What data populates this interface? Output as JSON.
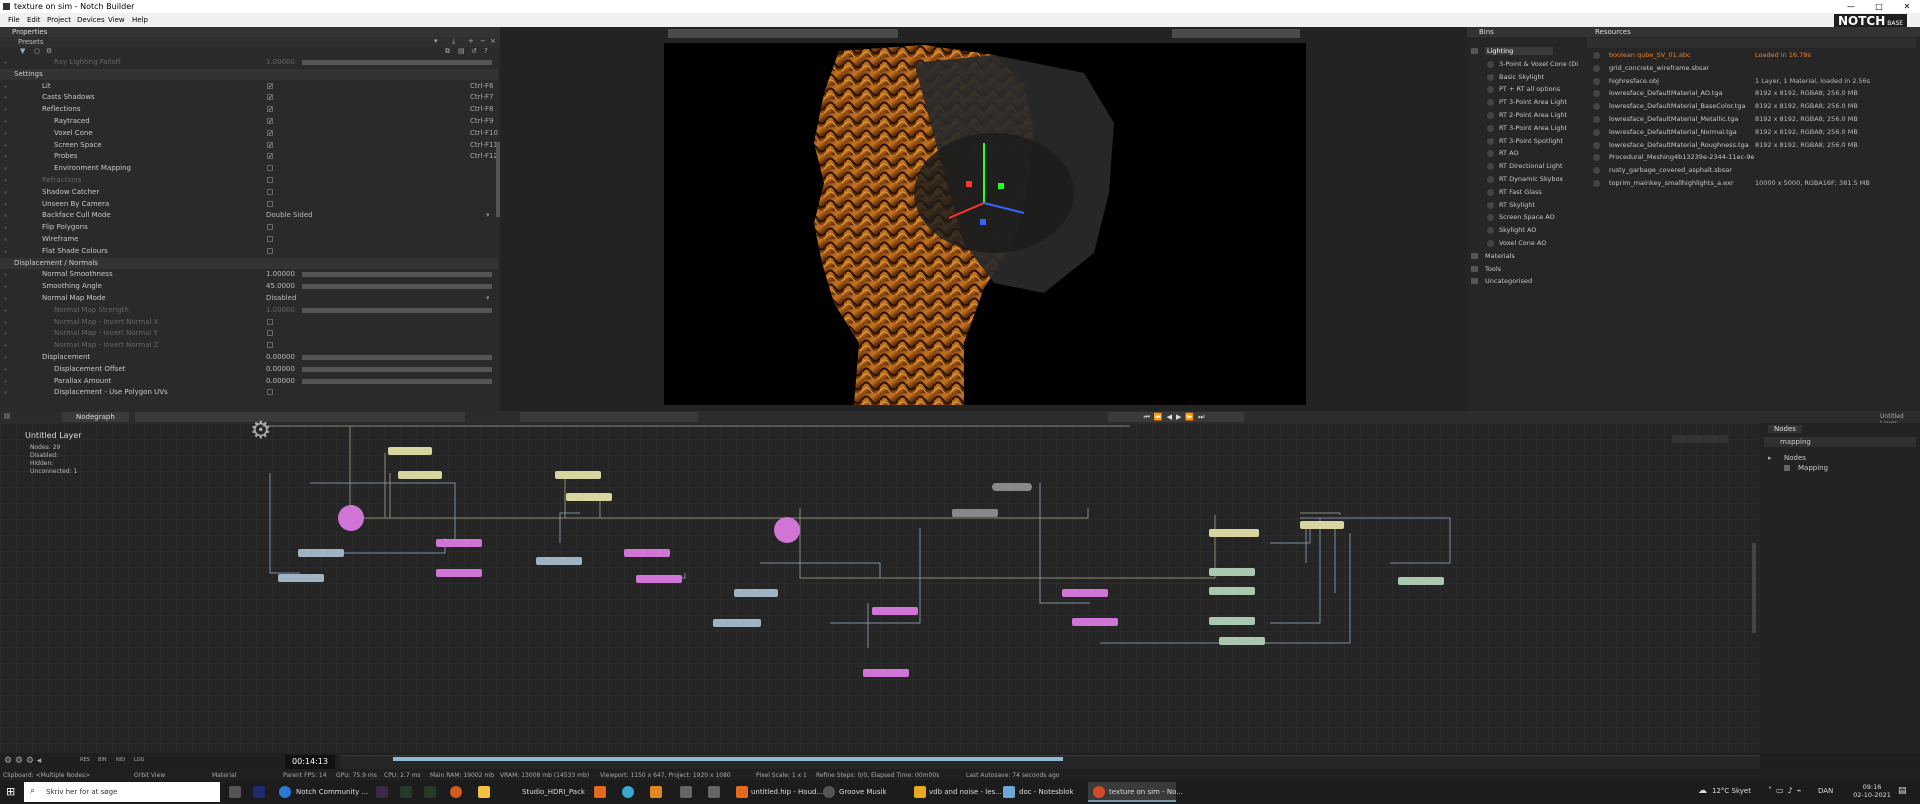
{
  "window": {
    "title": "texture on sim - Notch Builder",
    "min": "—",
    "max": "□",
    "close": "✕"
  },
  "menu": [
    "File",
    "Edit",
    "Project",
    "Devices",
    "View",
    "Help"
  ],
  "logo": {
    "text": "NOTCH",
    "sub": "BASE"
  },
  "properties": {
    "title": "Properties",
    "presets": "Presets",
    "rows": [
      {
        "label": "Ray Lighting Falloff",
        "value": "1.00000",
        "type": "slider",
        "indent": 54,
        "dim": true
      },
      {
        "label": "Settings",
        "type": "section"
      },
      {
        "label": "Lit",
        "type": "check",
        "checked": true,
        "shortcut": "Ctrl-F6",
        "indent": 42
      },
      {
        "label": "Casts Shadows",
        "type": "check",
        "checked": true,
        "shortcut": "Ctrl-F7",
        "indent": 42
      },
      {
        "label": "Reflections",
        "type": "check",
        "checked": true,
        "shortcut": "Ctrl-F8",
        "indent": 42
      },
      {
        "label": "Raytraced",
        "type": "check",
        "checked": true,
        "shortcut": "Ctrl-F9",
        "indent": 54
      },
      {
        "label": "Voxel Cone",
        "type": "check",
        "checked": true,
        "shortcut": "Ctrl-F10",
        "indent": 54
      },
      {
        "label": "Screen Space",
        "type": "check",
        "checked": true,
        "shortcut": "Ctrl-F11",
        "indent": 54
      },
      {
        "label": "Probes",
        "type": "check",
        "checked": true,
        "shortcut": "Ctrl-F12",
        "indent": 54
      },
      {
        "label": "Environment Mapping",
        "type": "check",
        "checked": false,
        "indent": 54
      },
      {
        "label": "Refractions",
        "type": "check",
        "checked": false,
        "indent": 42,
        "dim": true
      },
      {
        "label": "Shadow Catcher",
        "type": "check",
        "checked": false,
        "indent": 42
      },
      {
        "label": "Unseen By Camera",
        "type": "check",
        "checked": false,
        "indent": 42
      },
      {
        "label": "Backface Cull Mode",
        "type": "select",
        "value": "Double Sided",
        "indent": 42
      },
      {
        "label": "Flip Polygons",
        "type": "check",
        "checked": false,
        "indent": 42
      },
      {
        "label": "Wireframe",
        "type": "check",
        "checked": false,
        "indent": 42
      },
      {
        "label": "Flat Shade Colours",
        "type": "check",
        "checked": false,
        "indent": 42
      },
      {
        "label": "Displacement / Normals",
        "type": "section"
      },
      {
        "label": "Normal Smoothness",
        "type": "slider",
        "value": "1.00000",
        "indent": 42
      },
      {
        "label": "Smoothing Angle",
        "type": "slider",
        "value": "45.0000",
        "indent": 42
      },
      {
        "label": "Normal Map Mode",
        "type": "select",
        "value": "Disabled",
        "indent": 42
      },
      {
        "label": "Normal Map Strength",
        "type": "slider",
        "value": "1.00000",
        "indent": 54,
        "dim": true
      },
      {
        "label": "Normal Map - Invert Normal X",
        "type": "check",
        "checked": false,
        "indent": 54,
        "dim": true
      },
      {
        "label": "Normal Map - Invert Normal Y",
        "type": "check",
        "checked": false,
        "indent": 54,
        "dim": true
      },
      {
        "label": "Normal Map - Invert Normal Z",
        "type": "check",
        "checked": false,
        "indent": 54,
        "dim": true
      },
      {
        "label": "Displacement",
        "type": "slider",
        "value": "0.00000",
        "indent": 42
      },
      {
        "label": "Displacement Offset",
        "type": "slider",
        "value": "0.00000",
        "indent": 54
      },
      {
        "label": "Parallax Amount",
        "type": "slider",
        "value": "0.00000",
        "indent": 54
      },
      {
        "label": "Displacement - Use Polygon UVs",
        "type": "check",
        "checked": false,
        "indent": 54
      }
    ]
  },
  "bins": {
    "title": "Bins",
    "groups": [
      {
        "label": "Lighting",
        "selected": true
      },
      {
        "label": "3-Point & Voxel Cone (Di",
        "child": true
      },
      {
        "label": "Basic Skylight",
        "child": true
      },
      {
        "label": "PT + RT all options",
        "child": true
      },
      {
        "label": "PT 3-Point Area Light",
        "child": true
      },
      {
        "label": "RT 2-Point Area Light",
        "child": true
      },
      {
        "label": "RT 3-Point Area Light",
        "child": true
      },
      {
        "label": "RT 3-Point Spotlight",
        "child": true
      },
      {
        "label": "RT AO",
        "child": true
      },
      {
        "label": "RT Directional Light",
        "child": true
      },
      {
        "label": "RT Dynamic Skybox",
        "child": true
      },
      {
        "label": "RT Fast Glass",
        "child": true
      },
      {
        "label": "RT Skylight",
        "child": true
      },
      {
        "label": "Screen Space AO",
        "child": true
      },
      {
        "label": "Skylight AO",
        "child": true
      },
      {
        "label": "Voxel Cone AO",
        "child": true
      },
      {
        "label": "Materials"
      },
      {
        "label": "Tools"
      },
      {
        "label": "Uncategorised"
      }
    ]
  },
  "resources": {
    "title": "Resources",
    "items": [
      {
        "name": "boolean qube_SV_01.abc",
        "info": "Loaded in 16.79s",
        "highlight": true
      },
      {
        "name": "grid_concrete_wireframe.sbsar",
        "info": ""
      },
      {
        "name": "highresface.obj",
        "info": "1 Layer, 1 Material, loaded in 2.56s"
      },
      {
        "name": "lowresface_DefaultMaterial_AO.tga",
        "info": "8192 x 8192, RGBA8; 256.0 MB"
      },
      {
        "name": "lowresface_DefaultMaterial_BaseColor.tga",
        "info": "8192 x 8192, RGBA8; 256.0 MB"
      },
      {
        "name": "lowresface_DefaultMaterial_Metallic.tga",
        "info": "8192 x 8192, RGBA8; 256.0 MB"
      },
      {
        "name": "lowresface_DefaultMaterial_Normal.tga",
        "info": "8192 x 8192, RGBA8; 256.0 MB"
      },
      {
        "name": "lowresface_DefaultMaterial_Roughness.tga",
        "info": "8192 x 8192, RGBA8; 256.0 MB"
      },
      {
        "name": "Procedural_Meshing4b13239e-2344-11ec-9e0c-d",
        "info": ""
      },
      {
        "name": "rusty_garbage_covered_asphalt.sbsar",
        "info": ""
      },
      {
        "name": "toprim_mainkey_smallhighlights_a.exr",
        "info": "10000 x 5000, RGBA16F; 381.5 MB"
      }
    ]
  },
  "nodegraph": {
    "tab": "Nodegraph",
    "layer_title": "Untitled Layer",
    "stats": [
      "Nodes: 29",
      "Disabled:",
      "Hidden:",
      "Unconnected: 1"
    ]
  },
  "nodes_panel": {
    "tabs": [
      "Nodes"
    ],
    "search": "mapping",
    "tree": [
      "Nodes",
      "Mapping"
    ],
    "layer": "Untitled Layer"
  },
  "timeline": {
    "time": "00:14:13",
    "buttons": [
      "RES",
      "BIN",
      "NID",
      "LOG"
    ]
  },
  "status": [
    "Clipboard: <Multiple Nodes>",
    "Orbit View",
    "Material",
    "Parent  FPS: 14",
    "GPU: 75.9 ms",
    "CPU: 2.7 ms",
    "Main RAM: 19002 mb",
    "VRAM: 13008 mb (14533 mb)",
    "Viewport: 1150 x 647, Project: 1920 x 1080",
    "Pixel Scale: 1 x 1",
    "Refine Steps: 0/0, Elapsed Time: 00m00s",
    "Last Autosave: 74 seconds ago"
  ],
  "taskbar": {
    "search": "Skriv her for at søge",
    "apps": [
      "Notch Community ...",
      "Studio_HDRI_Pack",
      "untitled.hip - Houd...",
      "Groove Musik",
      "vdb and noise - les...",
      "doc - Notesblok",
      "texture on sim - No..."
    ],
    "weather": "12°C  Skyet",
    "lang": "DAN",
    "time": "09:16",
    "date": "02-10-2021"
  }
}
